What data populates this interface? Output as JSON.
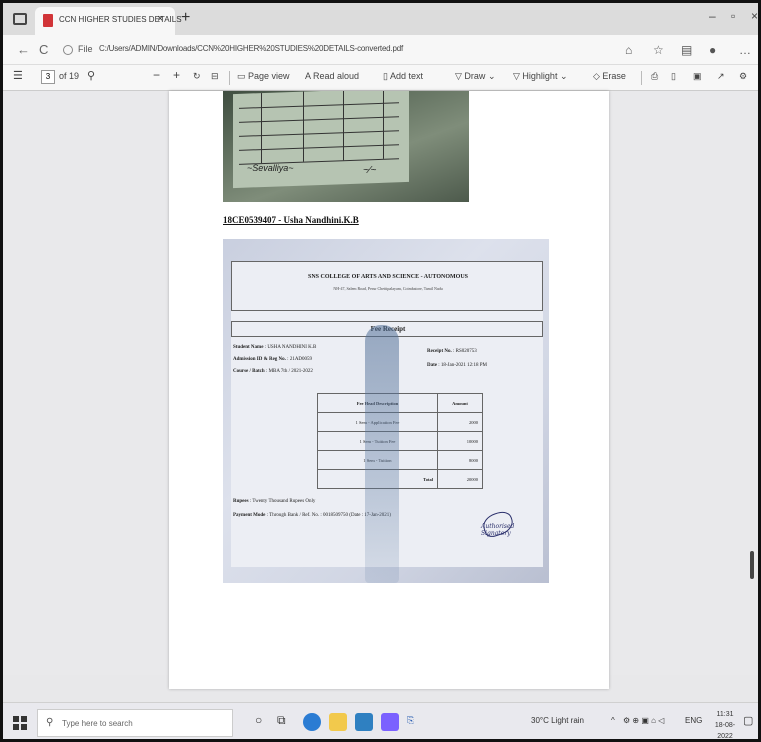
{
  "browser": {
    "tab_title": "CCN HIGHER STUDIES DETAILS",
    "tab_close": "×",
    "new_tab": "+",
    "window_controls": {
      "minimize": "–",
      "maximize": "▫",
      "close": "×"
    }
  },
  "address_bar": {
    "back": "←",
    "refresh": "C",
    "url_label": "File",
    "url": "C:/Users/ADMIN/Downloads/CCN%20HIGHER%20STUDIES%20DETAILS-converted.pdf"
  },
  "pdf_toolbar": {
    "contents": "☰",
    "page_number": "3",
    "page_total": "of 19",
    "zoom_out": "−",
    "zoom_in": "+",
    "page_view": "Page view",
    "read_aloud": "Read aloud",
    "add_text": "Add text",
    "draw": "Draw",
    "highlight": "Highlight",
    "erase": "Erase"
  },
  "document": {
    "student_heading": "18CE0539407 - Usha Nandhini.K.B",
    "receipt": {
      "college_name": "SNS COLLEGE OF ARTS AND SCIENCE - AUTONOMOUS",
      "college_address": "NH-47, Salem Road, Perur Chettipalayam, Coimbatore, Tamil Nadu",
      "title": "Fee Receipt",
      "student_name_label": "Student Name",
      "student_name": "USHA NANDHINI K.B",
      "admission_label": "Admission ID & Reg No.",
      "admission_value": "21AD0059",
      "course_label": "Course / Batch",
      "course_value": "MBA 7th / 2021-2022",
      "receipt_no_label": "Receipt No.",
      "receipt_no": "RS020753",
      "date_label": "Date",
      "date_value": "18-Jan-2021 12:18 PM",
      "table_headers": [
        "Fee Head Description",
        "Amount"
      ],
      "rows": [
        {
          "desc": "1 Sem - Application Fee",
          "amount": "2000"
        },
        {
          "desc": "1 Sem - Tuition Fee",
          "amount": "10000"
        },
        {
          "desc": "1 Sem - Tuition",
          "amount": "8000"
        }
      ],
      "total_label": "Total",
      "total_amount": "20000",
      "rupees_label": "Rupees",
      "rupees_value": "Twenty Thousand Rupees Only",
      "payment_label": "Payment Mode",
      "payment_value": "Through Bank / Ref. No. : 0018509750 (Date : 17-Jan-2021)",
      "signatory": "Authorised Signatory"
    }
  },
  "taskbar": {
    "search_placeholder": "Type here to search",
    "weather": "30°C  Light rain",
    "language": "ENG",
    "time": "11:31",
    "date": "18-08-2022"
  },
  "colors": {
    "pdf_icon": "#d13438",
    "page_bg": "#ffffff",
    "viewer_bg": "#e9e9eb",
    "taskbar_bg": "#e9e9ee"
  }
}
